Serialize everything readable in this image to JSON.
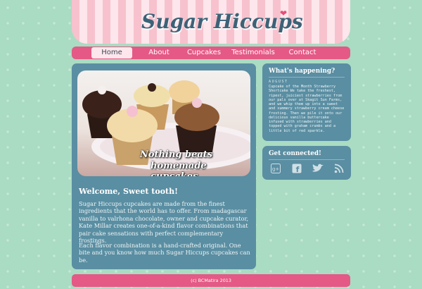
{
  "header": {
    "logo_text": "Sugar Hiccups"
  },
  "nav": {
    "items": [
      "Home",
      "About",
      "Cupcakes",
      "Testimonials",
      "Contact"
    ],
    "active": "Home"
  },
  "hero": {
    "tagline_line1": "Nothing beats",
    "tagline_line2": "homemade cupcakes"
  },
  "main": {
    "heading": "Welcome, Sweet tooth!",
    "paragraph1": "Sugar Hiccups cupcakes are made from the finest ingredients that the world has to offer. From madagascar vanilla to valrhona chocolate, owner and cupcake curator, Kate Millar creates one-of-a-kind flavor combinations that pair cake sensations with perfect complementary frostings.",
    "paragraph2": "Each flavor combination is a hand-crafted original. One bite and you know how much Sugar Hiccups cupcakes can be."
  },
  "sidebar": {
    "happening_title": "What's happening?",
    "happening_month": "AUGUST",
    "happening_text": "Cupcake of the Month Strawberry Shortcake We take the freshest, ripest, juiciest strawberries from our pals over at Skagit Sun Farms, and we whip them up into a sweet and summery strawberry cream cheese frosting. Then we pile it onto our delicious vanilla buttercake infused with strawberries and topped with graham crumbs and a little bit of red sparkle.",
    "connect_title": "Get connected!",
    "social_icons": [
      "google-plus-icon",
      "facebook-icon",
      "twitter-icon",
      "rss-icon"
    ]
  },
  "footer": {
    "text": "(c) BCMatira 2013"
  },
  "colors": {
    "background": "#a9dcc2",
    "nav": "#e45986",
    "panel": "#5a8ea2",
    "logo": "#3c6277"
  }
}
